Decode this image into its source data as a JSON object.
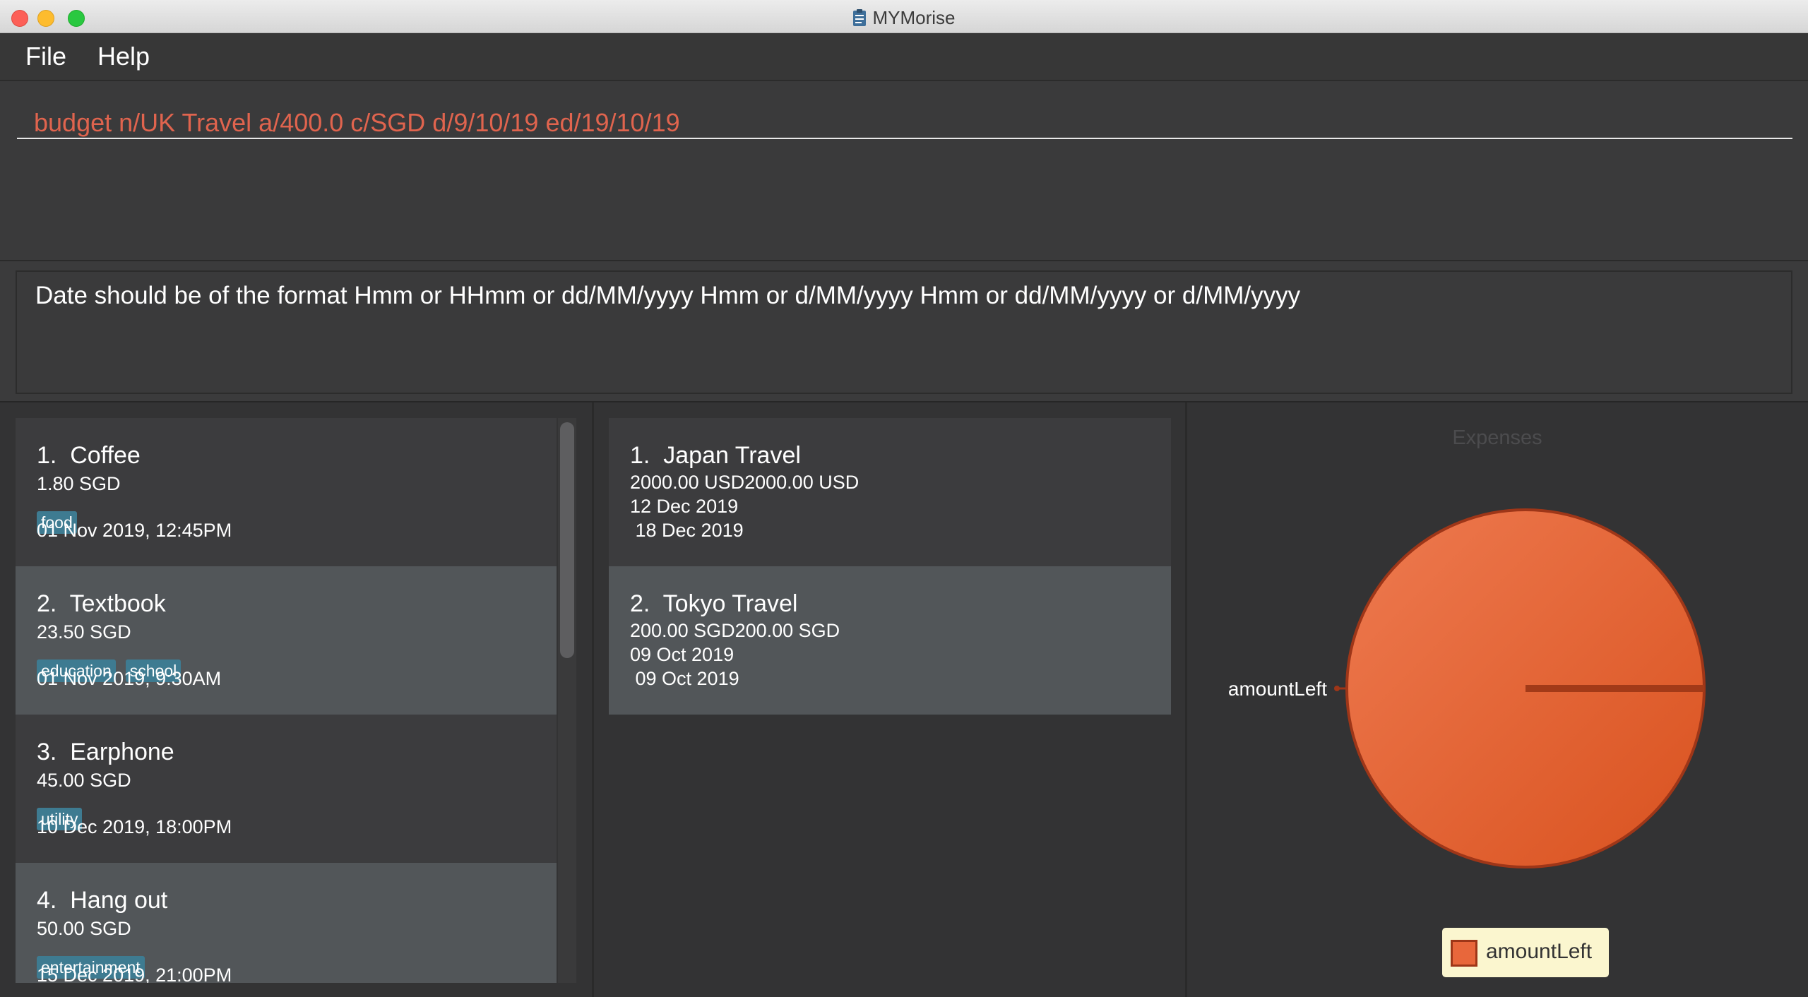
{
  "window": {
    "title": "MYMorise"
  },
  "menu": {
    "items": [
      "File",
      "Help"
    ]
  },
  "command": {
    "value": "budget n/UK Travel a/400.0 c/SGD d/9/10/19 ed/19/10/19"
  },
  "result": {
    "message": "Date should be of the format Hmm or HHmm or dd/MM/yyyy Hmm or d/MM/yyyy Hmm or dd/MM/yyyy or d/MM/yyyy"
  },
  "expenses": [
    {
      "title": "1.  Coffee",
      "amount": "1.80 SGD",
      "tags": [
        "food"
      ],
      "date": "01 Nov 2019, 12:45PM"
    },
    {
      "title": "2.  Textbook",
      "amount": "23.50 SGD",
      "tags": [
        "education",
        "school"
      ],
      "date": "01 Nov 2019, 9:30AM"
    },
    {
      "title": "3.  Earphone",
      "amount": "45.00 SGD",
      "tags": [
        "utility"
      ],
      "date": "10 Dec 2019, 18:00PM"
    },
    {
      "title": "4.  Hang out",
      "amount": "50.00 SGD",
      "tags": [
        "entertainment"
      ],
      "date": "15 Dec 2019, 21:00PM"
    }
  ],
  "budgets": [
    {
      "title": "1.  Japan Travel",
      "amount": "2000.00 USD2000.00 USD",
      "start": "12 Dec 2019",
      "end": " 18 Dec 2019"
    },
    {
      "title": "2.  Tokyo Travel",
      "amount": "200.00 SGD200.00 SGD",
      "start": "09 Oct 2019",
      "end": " 09 Oct 2019"
    }
  ],
  "chart_data": {
    "type": "pie",
    "title": "Expenses",
    "slices": [
      {
        "name": "amountLeft",
        "value": 100
      }
    ],
    "legend": {
      "position": "bottom",
      "entries": [
        "amountLeft"
      ]
    },
    "colors": {
      "fill": "#e8673b",
      "stroke": "#9e3618",
      "legend_bg": "#fbf6cf"
    }
  }
}
